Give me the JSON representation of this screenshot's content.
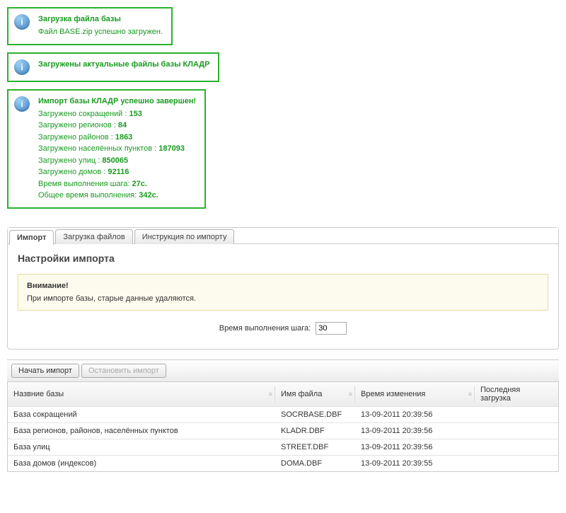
{
  "notices": [
    {
      "title": "Загрузка файла базы",
      "lines": [
        {
          "label": "Файл BASE.zip успешно загружен.",
          "value": ""
        }
      ]
    },
    {
      "title": "Загружены актуальные файлы базы КЛАДР",
      "lines": []
    },
    {
      "title": "Импорт базы КЛАДР успешно завершен!",
      "lines": [
        {
          "label": "Загружено сокращений : ",
          "value": "153"
        },
        {
          "label": "Загружено регионов : ",
          "value": "84"
        },
        {
          "label": "Загружено районов : ",
          "value": "1863"
        },
        {
          "label": "Загружено населённых пунктов : ",
          "value": "187093"
        },
        {
          "label": "Загружено улиц : ",
          "value": "850065"
        },
        {
          "label": "Загружено домов : ",
          "value": "92116"
        },
        {
          "label": "Время выполнения шага: ",
          "value": "27с."
        },
        {
          "label": "Общее время выполнения: ",
          "value": "342с."
        }
      ]
    }
  ],
  "tabs": {
    "import": "Импорт",
    "upload": "Загрузка файлов",
    "instructions": "Инструкция по импорту"
  },
  "panel": {
    "heading": "Настройки импорта",
    "alert_title": "Внимание!",
    "alert_body": "При импорте базы, старые данные удаляются.",
    "step_time_label": "Время выполнения шага:",
    "step_time_value": "30"
  },
  "toolbar": {
    "start": "Начать импорт",
    "stop": "Остановить импорт"
  },
  "grid": {
    "headers": {
      "name": "Назвние базы",
      "file": "Имя файла",
      "mtime": "Время изменения",
      "last": "Последняя загрузка"
    },
    "rows": [
      {
        "name": "База сокращений",
        "file": "SOCRBASE.DBF",
        "mtime": "13-09-2011 20:39:56",
        "last": ""
      },
      {
        "name": "База регионов, районов, населённых пунктов",
        "file": "KLADR.DBF",
        "mtime": "13-09-2011 20:39:56",
        "last": ""
      },
      {
        "name": "База улиц",
        "file": "STREET.DBF",
        "mtime": "13-09-2011 20:39:56",
        "last": ""
      },
      {
        "name": "База домов (индексов)",
        "file": "DOMA.DBF",
        "mtime": "13-09-2011 20:39:55",
        "last": ""
      }
    ]
  }
}
